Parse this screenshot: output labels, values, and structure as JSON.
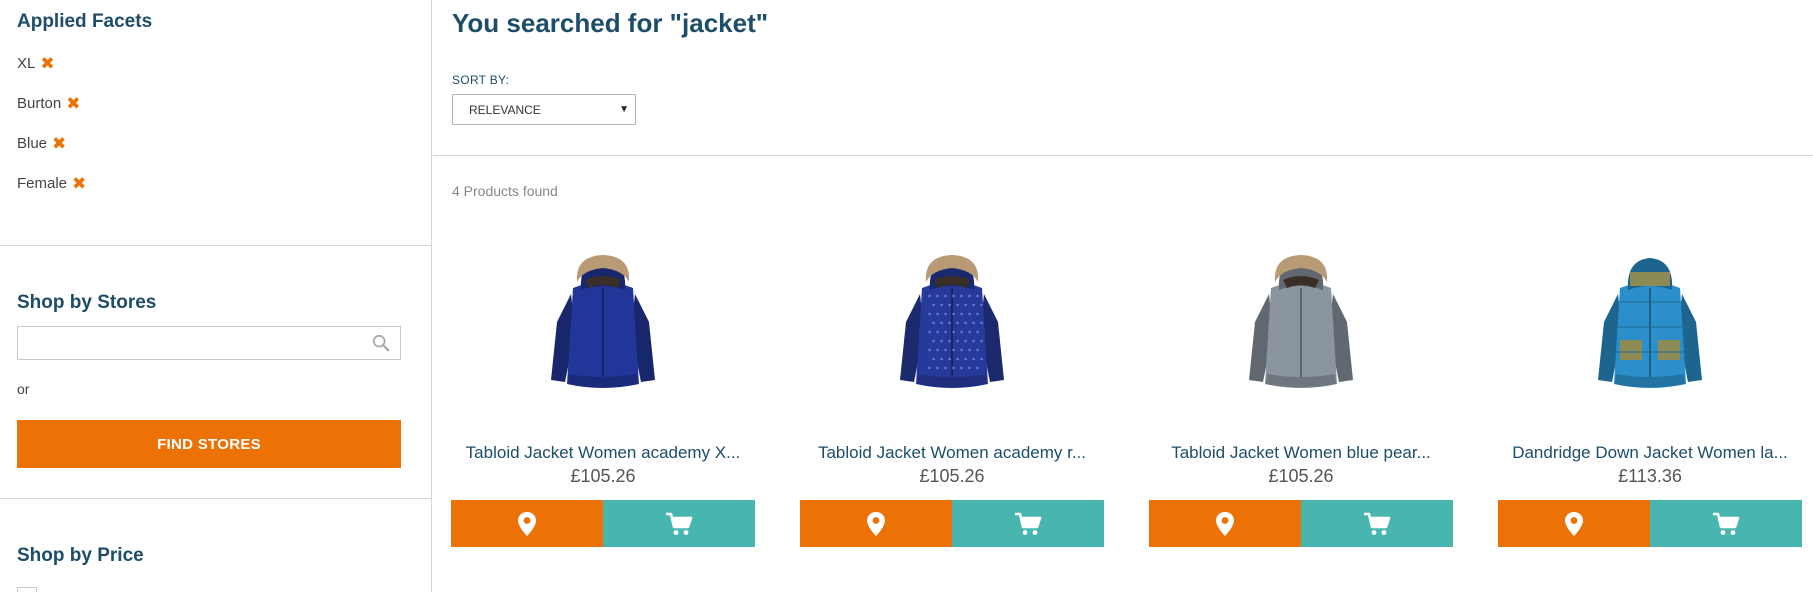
{
  "sidebar": {
    "applied_facets_title": "Applied Facets",
    "facets": [
      {
        "label": "XL",
        "remove_icon": "close-icon"
      },
      {
        "label": "Burton",
        "remove_icon": "close-icon"
      },
      {
        "label": "Blue",
        "remove_icon": "close-icon"
      },
      {
        "label": "Female",
        "remove_icon": "close-icon"
      }
    ],
    "shop_by_stores_title": "Shop by Stores",
    "store_search": {
      "value": "",
      "placeholder": "",
      "icon": "search-icon"
    },
    "or_text": "or",
    "find_stores_label": "FIND STORES",
    "shop_by_price_title": "Shop by Price"
  },
  "main": {
    "search_title": "You searched for \"jacket\"",
    "sort_label": "SORT BY:",
    "sort_value": "RELEVANCE",
    "products_found": "4 Products found",
    "products": [
      {
        "name": "Tabloid Jacket Women academy X...",
        "price": "£105.26",
        "color": "#22369a",
        "fur": true,
        "pattern": "plain"
      },
      {
        "name": "Tabloid Jacket Women academy r...",
        "price": "£105.26",
        "color": "#273a9c",
        "fur": true,
        "pattern": "dots"
      },
      {
        "name": "Tabloid Jacket Women blue pear...",
        "price": "£105.26",
        "color": "#8a959f",
        "fur": true,
        "pattern": "plain"
      },
      {
        "name": "Dandridge Down Jacket Women la...",
        "price": "£113.36",
        "color": "#2a8fcb",
        "fur": false,
        "pattern": "plaid"
      }
    ]
  },
  "colors": {
    "accent_orange": "#ec7206",
    "accent_teal": "#48b5ae",
    "heading_blue": "#1d4d68"
  }
}
